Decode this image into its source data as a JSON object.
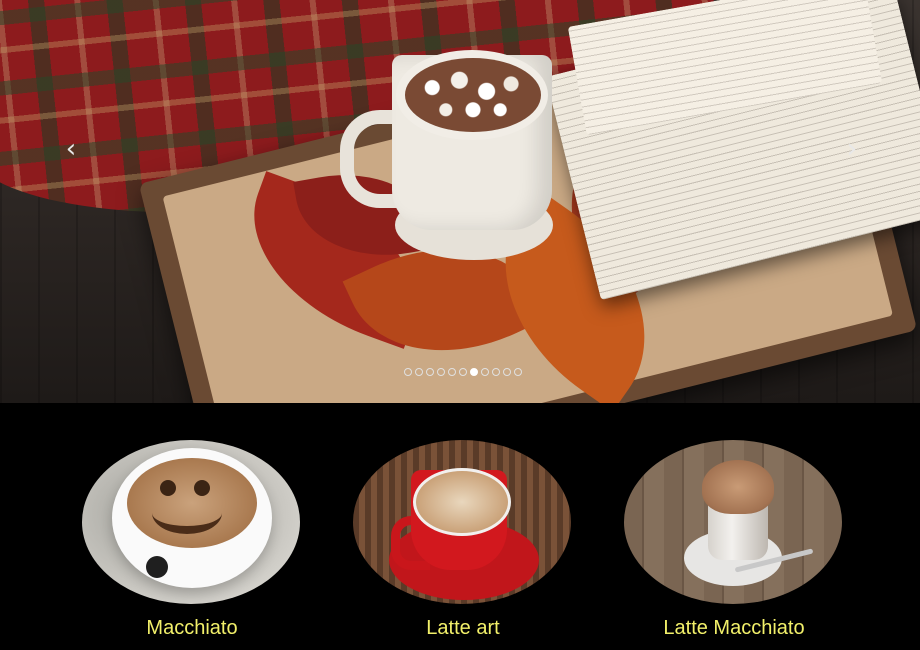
{
  "carousel": {
    "prev_icon": "‹",
    "next_icon": "›",
    "slide_count": 11,
    "active_slide": 6
  },
  "products": [
    {
      "label": "Macchiato",
      "image": "smiley-latte"
    },
    {
      "label": "Latte art",
      "image": "latte-art-red-cup"
    },
    {
      "label": "Latte Macchiato",
      "image": "latte-macchiato-glass"
    }
  ],
  "colors": {
    "background": "#000000",
    "label_color": "#f2f06a"
  }
}
